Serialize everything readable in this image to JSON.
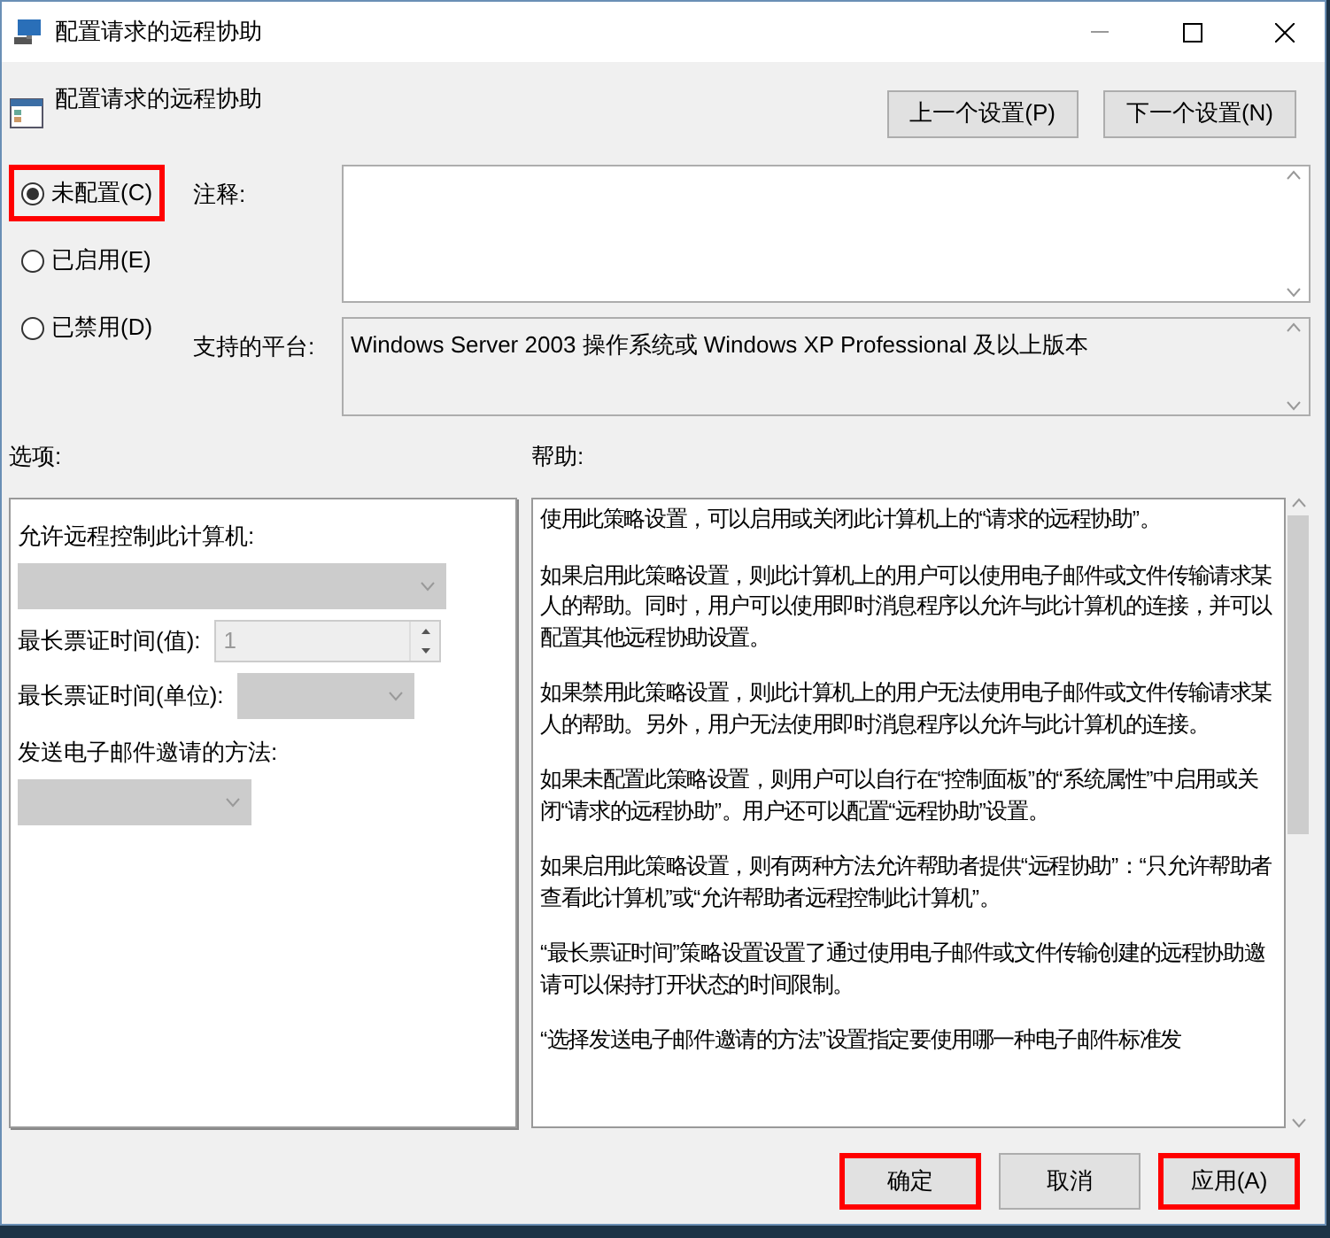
{
  "window": {
    "title": "配置请求的远程协助"
  },
  "header": {
    "title": "配置请求的远程协助",
    "buttons": [
      {
        "label": "上一个设置(P)"
      },
      {
        "label": "下一个设置(N)"
      }
    ]
  },
  "state_options": [
    {
      "label": "未配置(C)",
      "selected": true,
      "highlighted": true
    },
    {
      "label": "已启用(E)",
      "selected": false,
      "highlighted": false
    },
    {
      "label": "已禁用(D)",
      "selected": false,
      "highlighted": false
    }
  ],
  "comment": {
    "label": "注释:"
  },
  "platform": {
    "label": "支持的平台:",
    "value": "Windows Server 2003 操作系统或 Windows XP Professional 及以上版本"
  },
  "options": {
    "label": "选项:",
    "controls": [
      {
        "kind": "dropdown",
        "label": "允许远程控制此计算机:",
        "disabled": true
      },
      {
        "kind": "spinner",
        "label": "最长票证时间(值):",
        "value": "1",
        "disabled": true
      },
      {
        "kind": "inline-dropdown",
        "label": "最长票证时间(单位):",
        "disabled": true
      },
      {
        "kind": "small-dropdown",
        "label": "发送电子邮件邀请的方法:",
        "disabled": true
      }
    ]
  },
  "help": {
    "label": "帮助:",
    "paragraphs": [
      "使用此策略设置，可以启用或关闭此计算机上的“请求的远程协助”。",
      "如果启用此策略设置，则此计算机上的用户可以使用电子邮件或文件传输请求某人的帮助。同时，用户可以使用即时消息程序以允许与此计算机的连接，并可以配置其他远程协助设置。",
      "如果禁用此策略设置，则此计算机上的用户无法使用电子邮件或文件传输请求某人的帮助。另外，用户无法使用即时消息程序以允许与此计算机的连接。",
      "如果未配置此策略设置，则用户可以自行在“控制面板”的“系统属性”中启用或关闭“请求的远程协助”。用户还可以配置“远程协助”设置。",
      "如果启用此策略设置，则有两种方法允许帮助者提供“远程协助”：“只允许帮助者查看此计算机”或“允许帮助者远程控制此计算机”。",
      "“最长票证时间”策略设置设置了通过使用电子邮件或文件传输创建的远程协助邀请可以保持打开状态的时间限制。",
      "“选择发送电子邮件邀请的方法”设置指定要使用哪一种电子邮件标准发"
    ]
  },
  "footer": {
    "buttons": [
      {
        "label": "确定",
        "highlighted": true
      },
      {
        "label": "取消",
        "highlighted": false
      },
      {
        "label": "应用(A)",
        "highlighted": true
      }
    ]
  }
}
